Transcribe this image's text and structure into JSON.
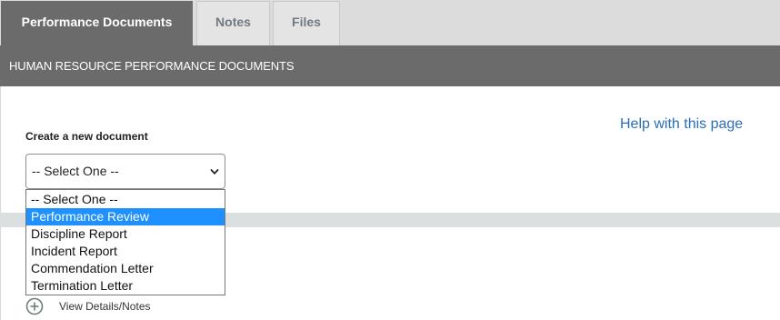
{
  "tabs": [
    {
      "label": "Performance Documents",
      "active": true
    },
    {
      "label": "Notes",
      "active": false
    },
    {
      "label": "Files",
      "active": false
    }
  ],
  "section": {
    "title": "HUMAN RESOURCE PERFORMANCE DOCUMENTS"
  },
  "help": {
    "label": "Help with this page"
  },
  "create": {
    "label": "Create a new document",
    "selected": "-- Select One --",
    "options": [
      "-- Select One --",
      "Performance Review",
      "Discipline Report",
      "Incident Report",
      "Commendation Letter",
      "Termination Letter"
    ],
    "highlighted_option": "Performance Review"
  },
  "details": {
    "label": "View Details/Notes",
    "icon": "plus-circle-icon"
  },
  "colors": {
    "header_bg": "#6b6b6b",
    "tabbar_bg": "#dcdcdc",
    "link": "#2a6db8",
    "highlight": "#1e90ff"
  }
}
